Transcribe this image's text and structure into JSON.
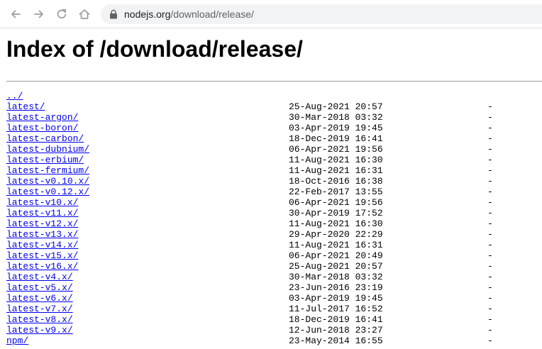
{
  "browser": {
    "url_host": "nodejs.org",
    "url_path": "/download/release/"
  },
  "page": {
    "title": "Index of /download/release/"
  },
  "entries": [
    {
      "name": "../",
      "date": "",
      "size": ""
    },
    {
      "name": "latest/",
      "date": "25-Aug-2021 20:57",
      "size": "-"
    },
    {
      "name": "latest-argon/",
      "date": "30-Mar-2018 03:32",
      "size": "-"
    },
    {
      "name": "latest-boron/",
      "date": "03-Apr-2019 19:45",
      "size": "-"
    },
    {
      "name": "latest-carbon/",
      "date": "18-Dec-2019 16:41",
      "size": "-"
    },
    {
      "name": "latest-dubnium/",
      "date": "06-Apr-2021 19:56",
      "size": "-"
    },
    {
      "name": "latest-erbium/",
      "date": "11-Aug-2021 16:30",
      "size": "-"
    },
    {
      "name": "latest-fermium/",
      "date": "11-Aug-2021 16:31",
      "size": "-"
    },
    {
      "name": "latest-v0.10.x/",
      "date": "18-Oct-2016 16:38",
      "size": "-"
    },
    {
      "name": "latest-v0.12.x/",
      "date": "22-Feb-2017 13:55",
      "size": "-"
    },
    {
      "name": "latest-v10.x/",
      "date": "06-Apr-2021 19:56",
      "size": "-"
    },
    {
      "name": "latest-v11.x/",
      "date": "30-Apr-2019 17:52",
      "size": "-"
    },
    {
      "name": "latest-v12.x/",
      "date": "11-Aug-2021 16:30",
      "size": "-"
    },
    {
      "name": "latest-v13.x/",
      "date": "29-Apr-2020 22:29",
      "size": "-"
    },
    {
      "name": "latest-v14.x/",
      "date": "11-Aug-2021 16:31",
      "size": "-"
    },
    {
      "name": "latest-v15.x/",
      "date": "06-Apr-2021 20:49",
      "size": "-"
    },
    {
      "name": "latest-v16.x/",
      "date": "25-Aug-2021 20:57",
      "size": "-"
    },
    {
      "name": "latest-v4.x/",
      "date": "30-Mar-2018 03:32",
      "size": "-"
    },
    {
      "name": "latest-v5.x/",
      "date": "23-Jun-2016 23:19",
      "size": "-"
    },
    {
      "name": "latest-v6.x/",
      "date": "03-Apr-2019 19:45",
      "size": "-"
    },
    {
      "name": "latest-v7.x/",
      "date": "11-Jul-2017 16:52",
      "size": "-"
    },
    {
      "name": "latest-v8.x/",
      "date": "18-Dec-2019 16:41",
      "size": "-"
    },
    {
      "name": "latest-v9.x/",
      "date": "12-Jun-2018 23:27",
      "size": "-"
    },
    {
      "name": "npm/",
      "date": "23-May-2014 16:55",
      "size": "-"
    }
  ]
}
